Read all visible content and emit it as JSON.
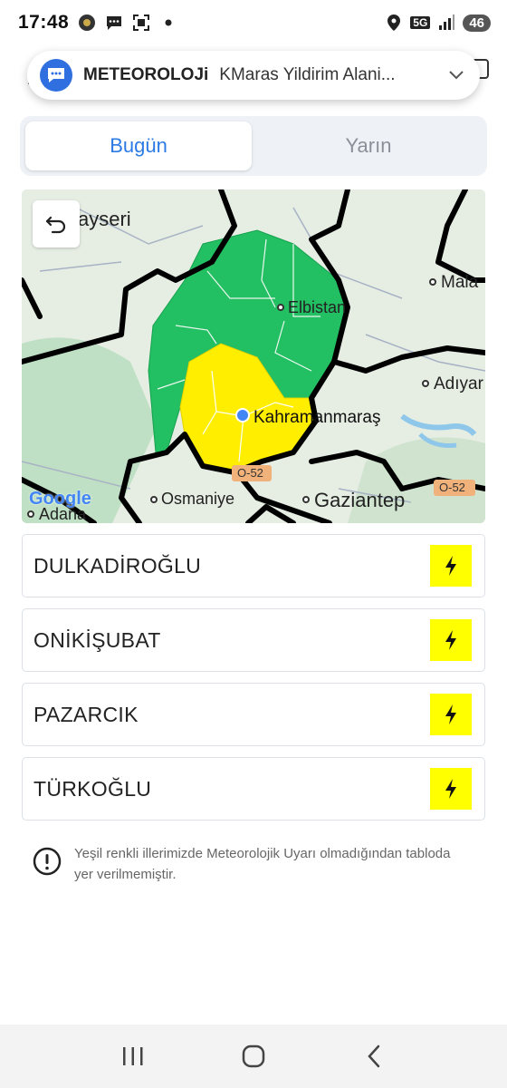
{
  "status": {
    "time": "17:48",
    "network": "5G",
    "battery": "46"
  },
  "notification": {
    "app": "METEOROLOJi",
    "message": "KMaras Yildirim Alani..."
  },
  "tabs": [
    {
      "label": "Bugün",
      "active": true
    },
    {
      "label": "Yarın",
      "active": false
    }
  ],
  "map": {
    "labels": {
      "kayseri": "ayseri",
      "elbistan": "Elbistan",
      "malatya": "Mala",
      "adiyaman": "Adıyar",
      "kahramanmaras": "Kahramanmaraş",
      "osmaniye": "Osmaniye",
      "gaziantep": "Gaziantep",
      "adana": "Adana",
      "road1": "O-52",
      "road2": "O-52",
      "google": "Google"
    },
    "colors": {
      "warning": "#ffee00",
      "no_warning": "#22c063"
    }
  },
  "districts": [
    {
      "name": "DULKADİROĞLU",
      "icon": "lightning-icon"
    },
    {
      "name": "ONİKİŞUBAT",
      "icon": "lightning-icon"
    },
    {
      "name": "PAZARCIK",
      "icon": "lightning-icon"
    },
    {
      "name": "TÜRKOĞLU",
      "icon": "lightning-icon"
    }
  ],
  "note": "Yeşil renkli illerimizde Meteorolojik Uyarı olmadığından tabloda yer verilmemiştir."
}
